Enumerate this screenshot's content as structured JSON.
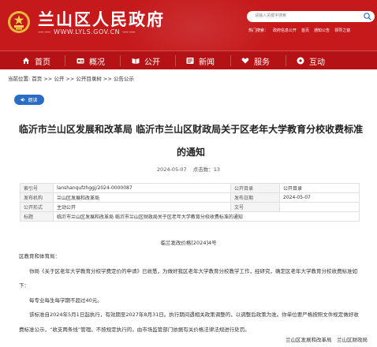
{
  "header": {
    "site_title": "兰山区人民政府",
    "site_url": "—— WWW.LYLS.GOV.CN ——",
    "search_placeholder": "请输入关键字搜索",
    "hotlinks": [
      "热门搜索：",
      "政府信息公开",
      "首页",
      "通知公告",
      "领导之窗"
    ],
    "colors": {
      "primary": "#c5191b",
      "nav": "#b41214"
    }
  },
  "nav": {
    "items": [
      {
        "label": "首页",
        "icon": "home-icon"
      },
      {
        "label": "概况",
        "icon": "overview-card-icon"
      },
      {
        "label": "公开",
        "icon": "open-book-icon"
      },
      {
        "label": "新闻",
        "icon": "newspaper-icon"
      },
      {
        "label": "服务",
        "icon": "heart-hand-icon"
      },
      {
        "label": "互动",
        "icon": "interaction-circle-icon"
      }
    ]
  },
  "breadcrumb": {
    "prefix": "当前位置:",
    "items": [
      "首页",
      "公开",
      "公开目录树",
      "公告公示"
    ],
    "separator": " >> "
  },
  "article": {
    "read_label": "朗读",
    "title": "临沂市兰山区发展和改革局 临沂市兰山区财政局关于区老年大学教育分校收费标准的通知",
    "date": "2024-05-07",
    "views_label": "点击数：",
    "views": "13",
    "meta": {
      "index_label": "索引号",
      "index_value": "lanshanqufzhggj/2024-0000087",
      "catalog_label": "公开目录",
      "catalog_value": "公开目录",
      "org_label": "发布机构",
      "org_value": "兰山区发展和改革局",
      "date_label": "发布日期",
      "date_value": "2024-05-07",
      "form_label": "公开形式",
      "form_value": "主动公开",
      "docno_label": "文号",
      "docno_value": "",
      "subject_label": "标题",
      "subject_value": "临沂市兰山区发展和改革局 临沂市兰山区财政局关于区老年大学教育分校收费标准的通知"
    },
    "doc_number": "临兰发改价格[2024]4号",
    "recipient": "区教育和体育局：",
    "paragraphs": [
      "你局《关于区老年大学教育分校学费定价的申请》已收悉，为做好我区老年大学教育分校教学工作，经研究，确定区老年大学教育分校收费标准如下：",
      "每专业每生每学期不超过40元。",
      "该标准自2024年5月1日起执行，有效期至2027年8月31日。执行期间遇相关政策调整的，以调整后政策为准。你单位要严格按照文件规定做好收费标准公示，“收支两条线”管理。不按规定执行的，由市场监管部门依据有关价格法律法规进行处罚。"
    ],
    "signature": "兰山区发展和改革局　兰山区财政局"
  }
}
